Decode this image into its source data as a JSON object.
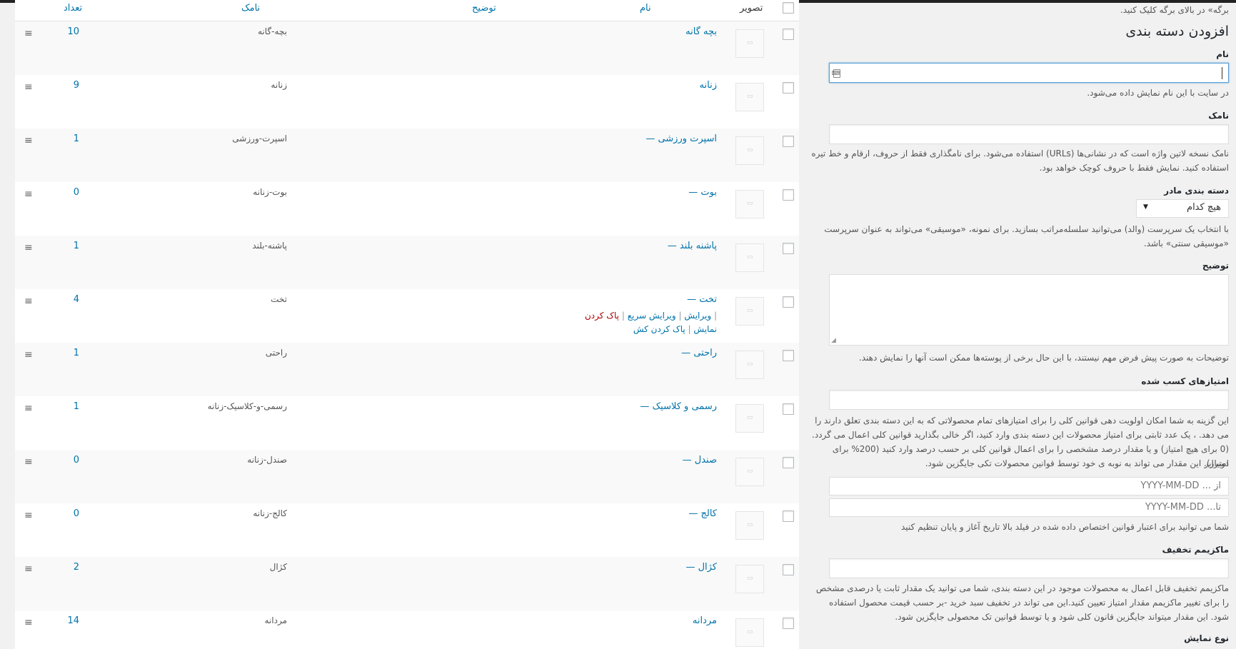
{
  "table": {
    "headers": {
      "image": "تصویر",
      "name": "نام",
      "description": "توضیح",
      "slug": "نامک",
      "count": "تعداد"
    },
    "rows": [
      {
        "name": "بچه گانه",
        "slug": "بچه-گانه",
        "count": "10"
      },
      {
        "name": "زنانه",
        "slug": "زنانه",
        "count": "9"
      },
      {
        "name": "— اسپرت ورزشی",
        "slug": "اسپرت-ورزشی",
        "count": "1"
      },
      {
        "name": "— بوت",
        "slug": "بوت-زنانه",
        "count": "0"
      },
      {
        "name": "— پاشنه بلند",
        "slug": "پاشنه-بلند",
        "count": "1"
      },
      {
        "name": "— تخت",
        "slug": "تخت",
        "count": "4"
      },
      {
        "name": "— راحتی",
        "slug": "راحتی",
        "count": "1"
      },
      {
        "name": "— رسمی و کلاسیک",
        "slug": "رسمی-و-کلاسیک-زنانه",
        "count": "1"
      },
      {
        "name": "— صندل",
        "slug": "صندل-زنانه",
        "count": "0"
      },
      {
        "name": "— کالج",
        "slug": "کالج-زنانه",
        "count": "0"
      },
      {
        "name": "— کژال",
        "slug": "کژال",
        "count": "2"
      },
      {
        "name": "مردانه",
        "slug": "مردانه",
        "count": "14"
      }
    ],
    "row_actions": {
      "edit": "ویرایش",
      "quick_edit": "ویرایش سریع",
      "delete": "پاک کردن",
      "view": "نمایش",
      "clear_cache": "پاک کردن کش"
    },
    "drag_icon": "≡",
    "thumb_icon": "image-placeholder-icon"
  },
  "form": {
    "top_note": "برگه» در بالای برگه کلیک کنید.",
    "title": "افزودن دسته بندی",
    "name_label": "نام",
    "name_desc": "در سایت با این نام نمایش داده می‌شود.",
    "slug_label": "نامک",
    "slug_desc_1": "نامک نسخه لاتین واژه است که در نشانی‌ها (URLs) استفاده می‌شود. برای نامگذاری فقط از حروف، ارقام و خط تیره",
    "slug_desc_2": "استفاده کنید. نمایش فقط با حروف کوچک خواهد بود.",
    "parent_label": "دسته بندی مادر",
    "parent_value": "هیچ کدام",
    "parent_desc_1": "با انتخاب یک سرپرست (والد) می‌توانید سلسله‌مراتب بسازید. برای نمونه، «موسیقی» می‌تواند به عنوان سرپرست",
    "parent_desc_2": "«موسیقی سنتی» باشد.",
    "description_label": "توضیح",
    "description_desc": "توضیحات به صورت پیش فرض مهم نیستند، با این حال برخی از پوسته‌ها ممکن است آنها را نمایش دهند.",
    "points_label": "امتیازهای کسب شده",
    "points_desc_1": "این گزینه به شما امکان اولویت دهی قوانین کلی را برای امتیازهای تمام محصولاتی که به این دسته بندی تعلق دارند را",
    "points_desc_2": "می دهد. ، یک عدد ثابتی برای امتیاز محصولات این دسته بندی وارد کنید، اگر خالی بگذارید قوانین کلی اعمال می گردد.",
    "points_desc_3": "(0 برای هیچ امتیاز) و یا مقدار درصد مشخصی را برای اعمال قوانین کلی بر حسب درصد وارد کنید (200% برای دوبرابر",
    "points_desc_4": "امتیاز). این مقدار می تواند به نوبه ی خود توسط قوانین محصولات تکی جایگزین شود.",
    "date_from": "از ...  YYYY-MM-DD",
    "date_to": "تا...  YYYY-MM-DD",
    "date_desc": "شما می توانید برای اعتبار قوانین اختصاص داده شده در فیلد بالا تاریخ آغاز و پایان تنظیم کنید",
    "max_discount_label": "ماکزیمم تخفیف",
    "max_desc_1": "ماکزیمم تخفیف قابل اعمال به محصولات موجود در این دسته بندی، شما می توانید یک مقدار ثابت یا درصدی مشخص",
    "max_desc_2": "را برای تغییر ماکزیمم مقدار امتیاز تعیین کنید.این می تواند در تخفیف سبد خرید -بر حسب قیمت محصول استفاده",
    "max_desc_3": "شود. این مقدار میتواند جایگزین قانون کلی شود و یا توسط قوانین تک محصولی جایگزین شود.",
    "display_type_label": "نوع نمایش"
  }
}
